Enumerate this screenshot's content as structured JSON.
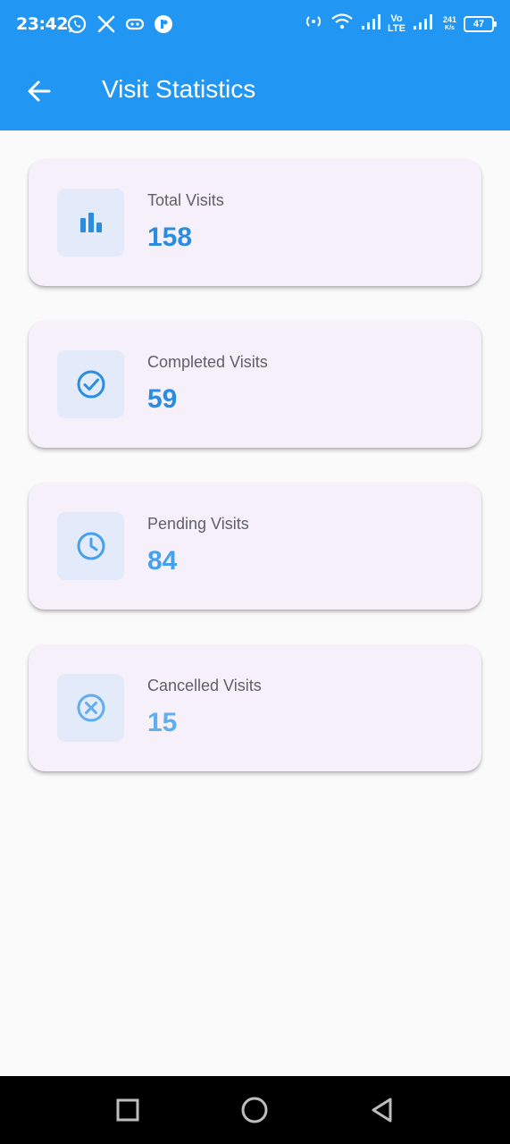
{
  "status_bar": {
    "time": "23:42",
    "left_icons": [
      "whatsapp-icon",
      "x-icon",
      "gamepad-icon",
      "app-icon"
    ],
    "right_icons": [
      "hotspot-icon",
      "wifi-icon",
      "signal-icon",
      "volte-icon",
      "signal-icon"
    ],
    "volte_top": "Vo",
    "volte_bottom": "LTE",
    "speed_value": "241",
    "speed_unit": "K/s",
    "battery": "47"
  },
  "app_bar": {
    "title": "Visit Statistics",
    "back_icon": "arrow-back-icon",
    "background": "#2196F3"
  },
  "stats": [
    {
      "label": "Total Visits",
      "value": "158",
      "icon": "bar-chart-icon",
      "color": "#2B8DE0"
    },
    {
      "label": "Completed Visits",
      "value": "59",
      "icon": "check-circle-icon",
      "color": "#2B8DE0"
    },
    {
      "label": "Pending Visits",
      "value": "84",
      "icon": "clock-icon",
      "color": "#45A1EE"
    },
    {
      "label": "Cancelled Visits",
      "value": "15",
      "icon": "cancel-circle-icon",
      "color": "#61AEEF"
    }
  ],
  "nav_bar": {
    "buttons": [
      "recents-square-icon",
      "home-circle-icon",
      "back-triangle-icon"
    ]
  }
}
